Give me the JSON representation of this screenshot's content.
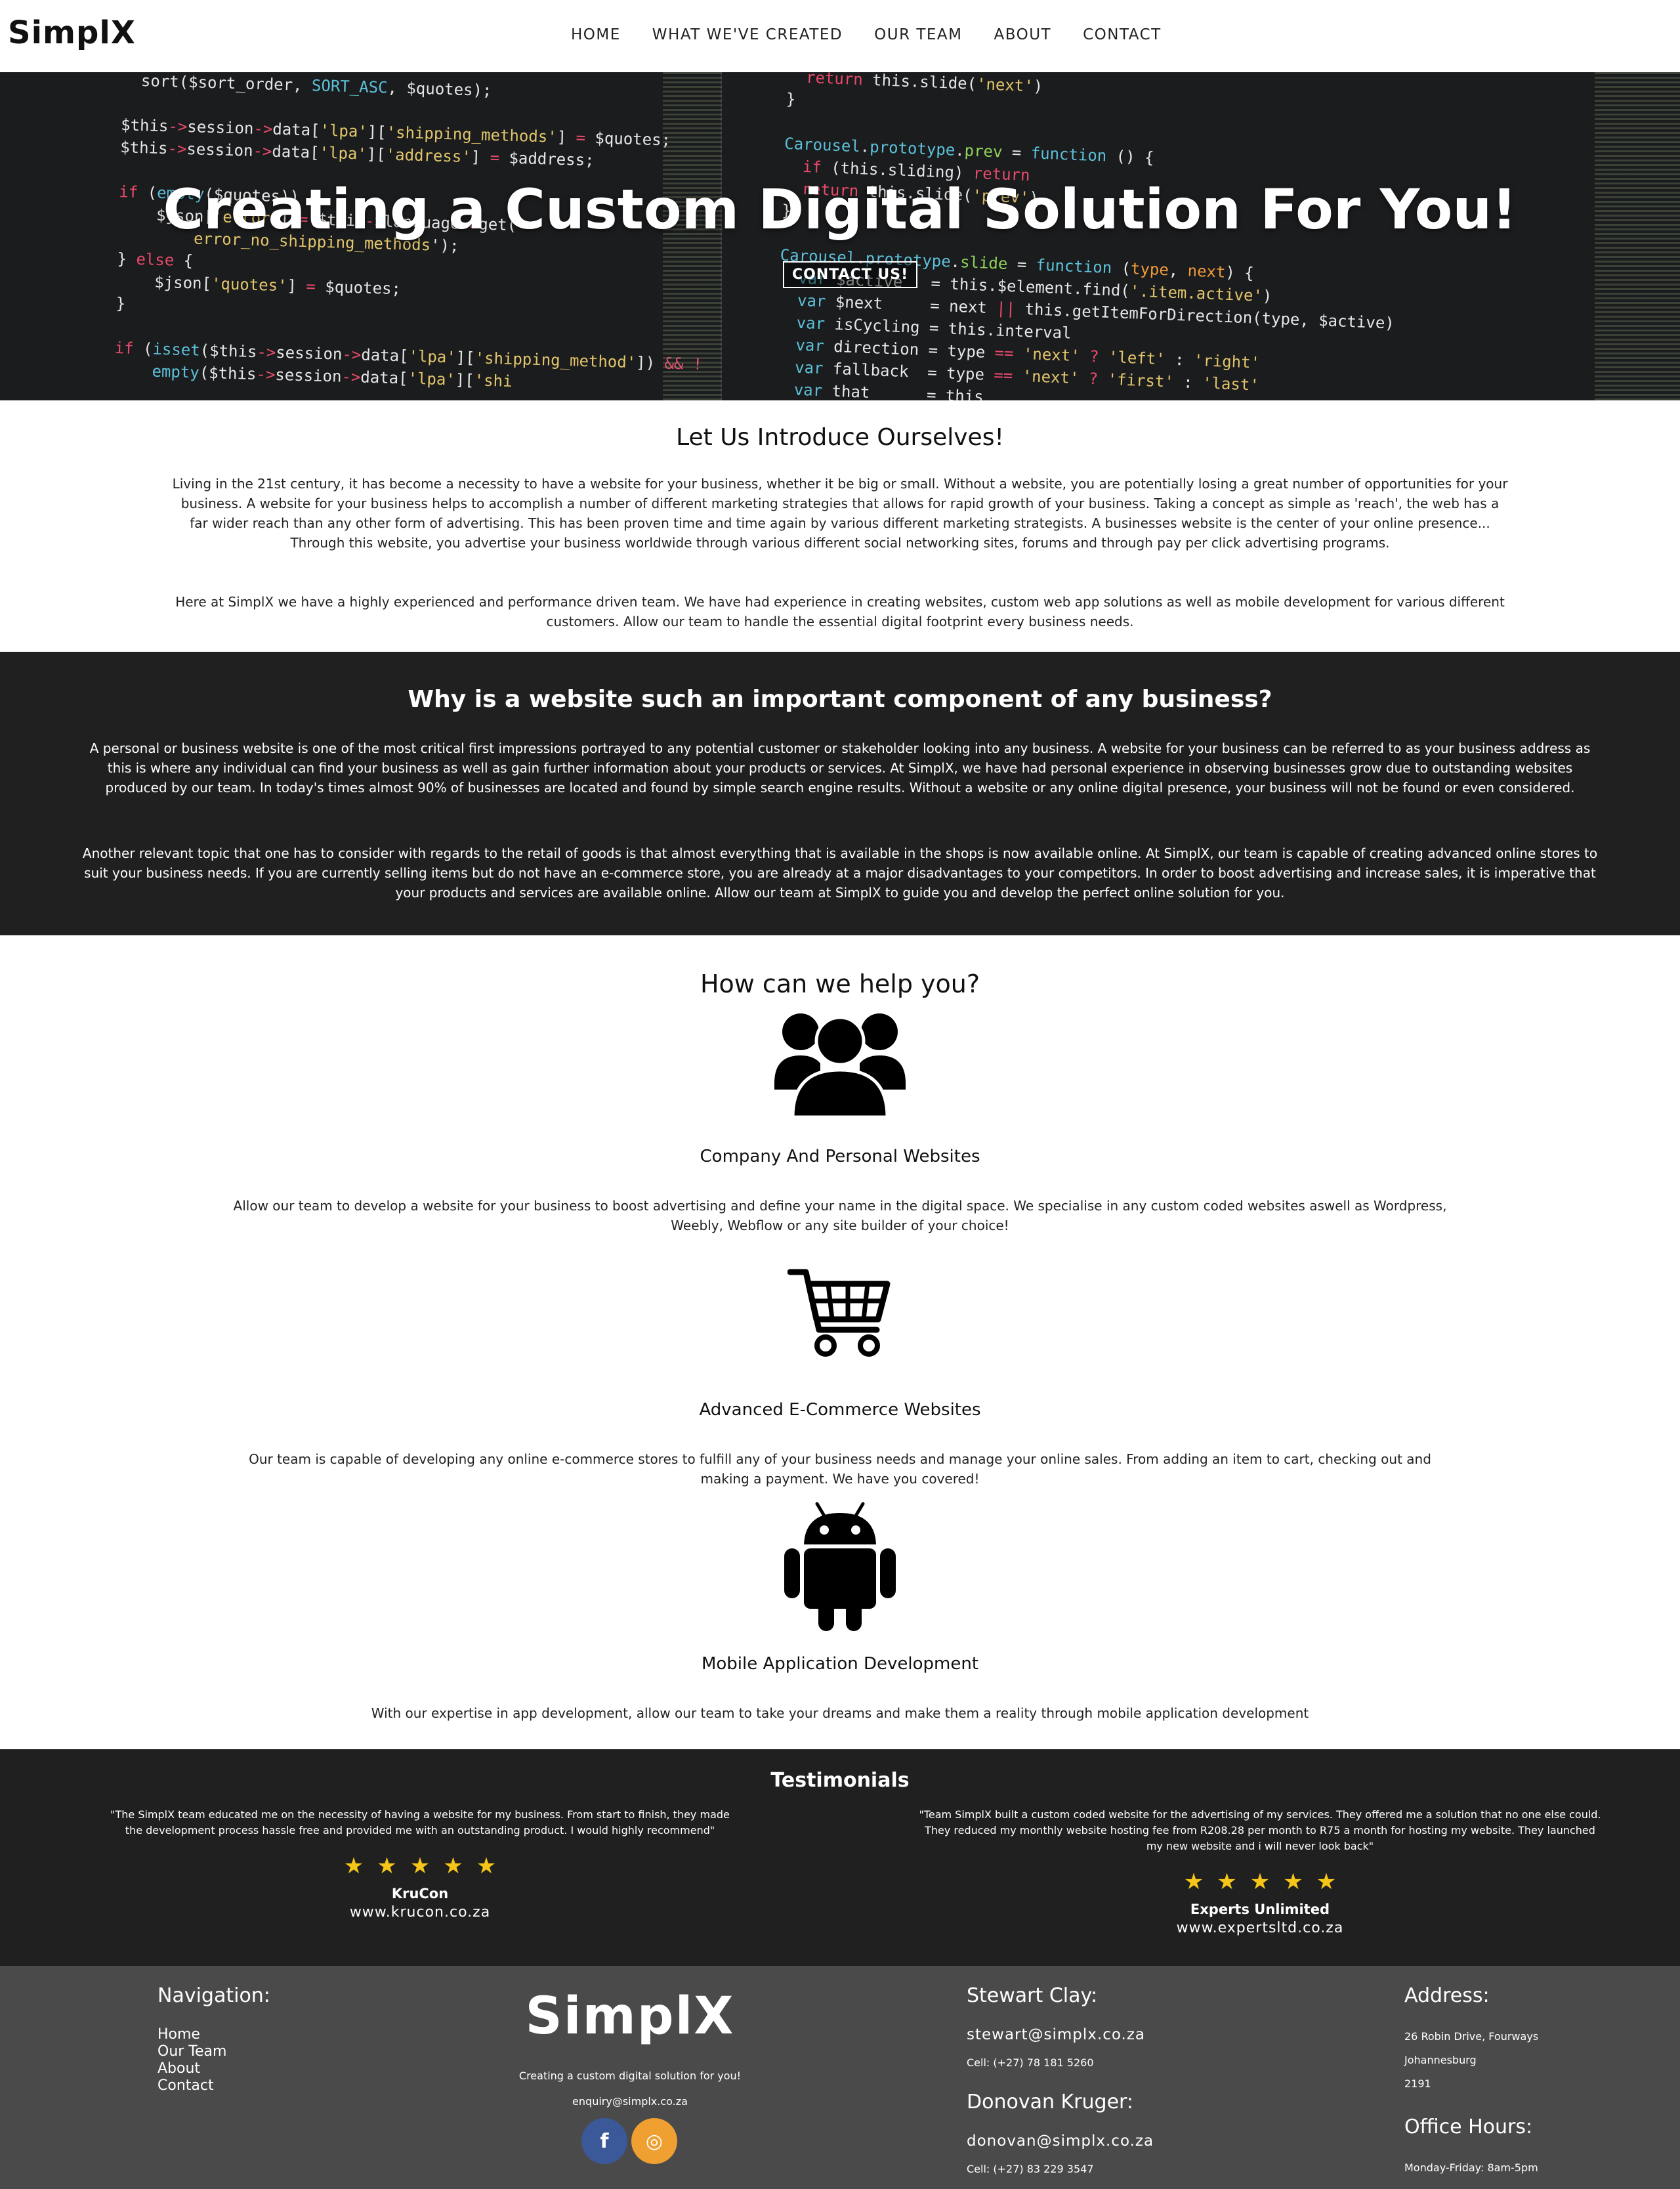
{
  "header": {
    "logo": "SimplX",
    "nav": [
      "HOME",
      "WHAT WE'VE CREATED",
      "OUR TEAM",
      "ABOUT",
      "CONTACT"
    ]
  },
  "hero": {
    "title": "Creating a Custom Digital Solution For You!",
    "button": "CONTACT US!"
  },
  "intro": {
    "title": "Let Us Introduce Ourselves!",
    "p1": "Living in the 21st century, it has become a necessity to have a website for your business, whether it be big or small. Without a website, you are potentially losing a great number of opportunities for your business. A website for your business helps to accomplish a number of different marketing strategies that allows for rapid growth of your business. Taking a concept as simple as 'reach', the web has a far wider reach than any other form of advertising. This has been proven time and time again by various different marketing strategists. A businesses website is the center of your online presence... Through this website, you advertise your business worldwide through various different social networking sites, forums and through pay per click advertising programs.",
    "p2": "Here at SimplX we have a highly experienced and performance driven team. We have had experience in creating websites, custom web app solutions as well as mobile development for various different customers. Allow our team to handle the essential digital footprint every business needs."
  },
  "why": {
    "title": "Why is a website such an important component of any business?",
    "p1": "A personal or business website is one of the most critical first impressions portrayed to any potential customer or stakeholder looking into any business. A website for your business can be referred to as your business address as this is where any individual can find your business as well as gain further information about your products or services. At SimplX, we have had personal experience in observing businesses grow due to outstanding websites produced by our team. In today's times almost 90% of businesses are located and found by simple search engine results. Without a website or any online digital presence, your business will not be found or even considered.",
    "p2": "Another relevant topic that one has to consider with regards to the retail of goods is that almost everything that is available in the shops is now available online. At SimplX, our team is capable of creating advanced online stores to suit your business needs. If you are currently selling items but do not have an e-commerce store, you are already at a major disadvantages to your competitors. In order to boost advertising and increase sales, it is imperative that your products and services are available online. Allow our team at SimplX to guide you and develop the perfect online solution for you."
  },
  "help": {
    "title": "How can we help you?",
    "services": [
      {
        "icon": "users-icon",
        "title": "Company And Personal Websites",
        "desc": "Allow our team to develop a website for your business to boost advertising and define your name in the digital space. We specialise in any custom coded websites aswell as Wordpress, Weebly, Webflow or any site builder of your choice!"
      },
      {
        "icon": "shopping-cart-icon",
        "title": "Advanced E-Commerce Websites",
        "desc": "Our team is capable of developing any online e-commerce stores to fulfill any of your business needs and manage your online sales. From adding an item to cart, checking out and making a payment. We have you covered!"
      },
      {
        "icon": "android-icon",
        "title": "Mobile Application Development",
        "desc": "With our expertise in app development, allow our team to take your dreams and make them a reality through mobile application development"
      }
    ]
  },
  "testimonials": {
    "title": "Testimonials",
    "items": [
      {
        "quote": "\"The SimplX team educated me on the necessity of having a website for my business. From start to finish, they made the development process hassle free and provided me with an outstanding product. I would highly recommend\"",
        "stars": "★★★★★",
        "name": "KruCon",
        "site": "www.krucon.co.za"
      },
      {
        "quote": "\"Team SimplX built a custom coded website for the advertising of my services. They offered me a solution that no one else could. They reduced my monthly website hosting fee from R208.28 per month to R75 a month for hosting my website. They launched my new website and i will never look back\"",
        "stars": "★★★★★",
        "name": "Experts Unlimited",
        "site": "www.expertsltd.co.za"
      }
    ]
  },
  "footer": {
    "nav_title": "Navigation:",
    "nav_links": [
      "Home",
      "Our Team",
      "About",
      "Contact"
    ],
    "logo": "SimplX",
    "tagline": "Creating a custom digital solution for you!",
    "enquiry": "enquiry@simplx.co.za",
    "social": [
      "f",
      "◎"
    ],
    "contact1_name": "Stewart Clay:",
    "contact1_email": "stewart@simplx.co.za",
    "contact1_cell": "Cell: (+27) 78 181 5260",
    "contact2_name": "Donovan Kruger:",
    "contact2_email": "donovan@simplx.co.za",
    "contact2_cell": "Cell: (+27) 83 229 3547",
    "address_title": "Address:",
    "address": [
      "26 Robin Drive, Fourways",
      "Johannesburg",
      "2191"
    ],
    "hours_title": "Office Hours:",
    "hours": "Monday-Friday: 8am-5pm"
  },
  "colors": {
    "dark_section": "#202020",
    "footer_bg": "#4a4a4a",
    "star": "#f5c518",
    "facebook": "#3b5998",
    "instagram": "#f0a030"
  }
}
